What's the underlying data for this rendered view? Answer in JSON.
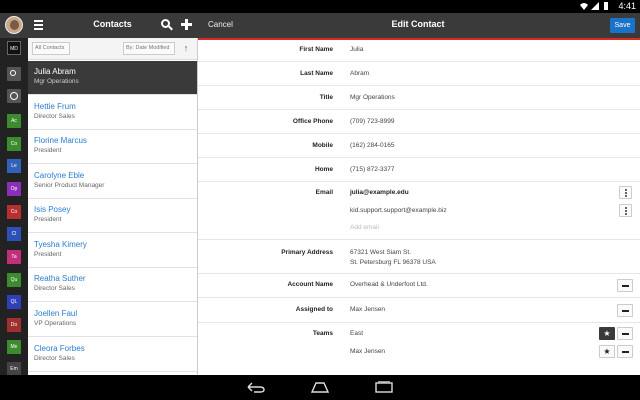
{
  "status_bar": {
    "time": "4:41"
  },
  "header": {
    "list_title": "Contacts",
    "cancel_label": "Cancel",
    "edit_title": "Edit Contact",
    "save_label": "Save"
  },
  "rail": {
    "items": [
      "MD",
      "",
      "",
      "Ac",
      "Co",
      "Le",
      "Op",
      "Co",
      "Cl",
      "Ta",
      "Qu",
      "QL",
      "Do",
      "Me",
      "Em"
    ],
    "colors": [
      "#111111",
      "#555555",
      "#555555",
      "#3d8b2f",
      "#3d8b2f",
      "#2f62b8",
      "#8b2fb8",
      "#b82f2f",
      "#2f4fb8",
      "#c02f7a",
      "#3d8b2f",
      "#2f3fb8",
      "#a02f2f",
      "#3d8b2f",
      "#444444"
    ]
  },
  "list": {
    "filter_label": "All Contacts",
    "sort_label": "By: Date Modified",
    "contacts": [
      {
        "name": "Julia Abram",
        "title": "Mgr Operations",
        "selected": true
      },
      {
        "name": "Hettie Frum",
        "title": "Director Sales"
      },
      {
        "name": "Florine Marcus",
        "title": "President"
      },
      {
        "name": "Carolyne Eble",
        "title": "Senior Product Manager"
      },
      {
        "name": "Isis Posey",
        "title": "President"
      },
      {
        "name": "Tyesha Kimery",
        "title": "President"
      },
      {
        "name": "Reatha Suther",
        "title": "Director Sales"
      },
      {
        "name": "Joellen Faul",
        "title": "VP Operations"
      },
      {
        "name": "Cleora Forbes",
        "title": "Director Sales"
      }
    ]
  },
  "form": {
    "first_name": {
      "label": "First Name",
      "value": "Julia"
    },
    "last_name": {
      "label": "Last Name",
      "value": "Abram"
    },
    "title": {
      "label": "Title",
      "value": "Mgr Operations"
    },
    "office_phone": {
      "label": "Office Phone",
      "value": "(709) 723-8999"
    },
    "mobile": {
      "label": "Mobile",
      "value": "(162) 284-0165"
    },
    "home": {
      "label": "Home",
      "value": "(715) 872-3377"
    },
    "email": {
      "label": "Email",
      "primary": "julia@example.edu",
      "secondary": "kid.support.support@example.biz",
      "placeholder": "Add email"
    },
    "primary_address": {
      "label": "Primary Address",
      "line1": "67321 West Siam St.",
      "line2": "St. Petersburg FL 96378 USA"
    },
    "account_name": {
      "label": "Account Name",
      "value": "Overhead & Underfoot Ltd."
    },
    "assigned_to": {
      "label": "Assigned to",
      "value": "Max Jensen"
    },
    "teams": {
      "label": "Teams",
      "team1": "East",
      "team2": "Max Jensen"
    }
  }
}
